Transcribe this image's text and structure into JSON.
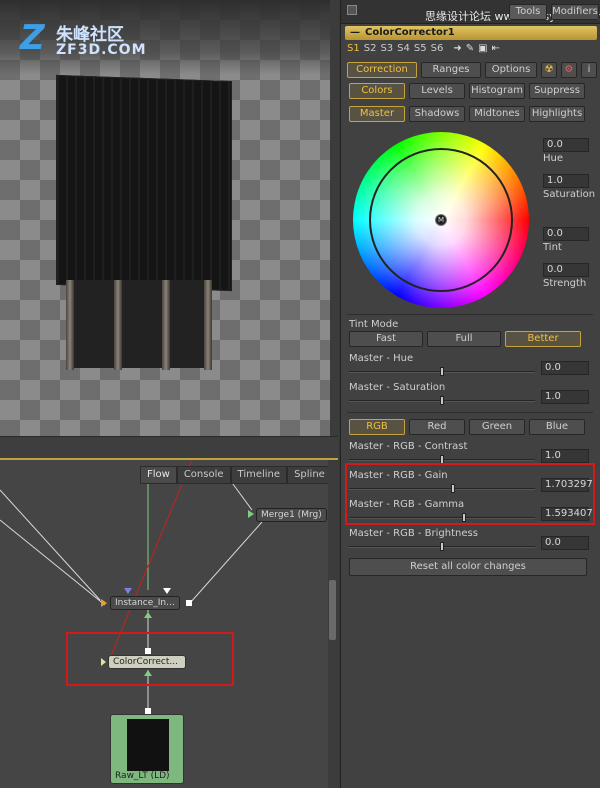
{
  "watermark": {
    "brand": "朱峰社区",
    "site": "ZF3D.COM",
    "top_right": "思缘设计论坛 www.missyuan.com"
  },
  "flow": {
    "tabs": [
      {
        "label": "Flow",
        "active": true
      },
      {
        "label": "Console",
        "active": false
      },
      {
        "label": "Timeline",
        "active": false
      },
      {
        "label": "Spline",
        "active": false
      }
    ],
    "info": "i",
    "nodes": {
      "merge": "Merge1  (Mrg)",
      "instance": "Instance_In...",
      "colorcorrector": "ColorCorrect...",
      "raw": "Raw_LT (LD)"
    }
  },
  "panel": {
    "header_tabs": [
      "Tools",
      "Modifiers"
    ],
    "title": "ColorCorrector1",
    "slots": [
      "S1",
      "S2",
      "S3",
      "S4",
      "S5",
      "S6"
    ],
    "tabs": [
      {
        "label": "Correction",
        "active": true
      },
      {
        "label": "Ranges",
        "active": false
      },
      {
        "label": "Options",
        "active": false
      }
    ],
    "modes": [
      {
        "label": "Colors",
        "active": true
      },
      {
        "label": "Levels",
        "active": false
      },
      {
        "label": "Histogram",
        "active": false
      },
      {
        "label": "Suppress",
        "active": false
      }
    ],
    "ranges": [
      {
        "label": "Master",
        "active": true
      },
      {
        "label": "Shadows",
        "active": false
      },
      {
        "label": "Midtones",
        "active": false
      },
      {
        "label": "Highlights",
        "active": false
      }
    ],
    "wheel": {
      "center_label": "M",
      "hue": {
        "label": "Hue",
        "value": "0.0"
      },
      "saturation": {
        "label": "Saturation",
        "value": "1.0"
      },
      "tint": {
        "label": "Tint",
        "value": "0.0"
      },
      "strength": {
        "label": "Strength",
        "value": "0.0"
      }
    },
    "tint_mode": {
      "label": "Tint Mode",
      "options": [
        {
          "label": "Fast",
          "active": false
        },
        {
          "label": "Full",
          "active": false
        },
        {
          "label": "Better",
          "active": true
        }
      ]
    },
    "sliders_top": [
      {
        "label": "Master - Hue",
        "value": "0.0",
        "level": 0.5
      },
      {
        "label": "Master - Saturation",
        "value": "1.0",
        "level": 0.5
      }
    ],
    "channels": [
      {
        "label": "RGB",
        "active": true
      },
      {
        "label": "Red",
        "active": false
      },
      {
        "label": "Green",
        "active": false
      },
      {
        "label": "Blue",
        "active": false
      }
    ],
    "sliders_rgb": [
      {
        "label": "Master - RGB - Contrast",
        "value": "1.0",
        "level": 0.5
      },
      {
        "label": "Master - RGB - Gain",
        "value": "1.703297",
        "level": 0.56
      },
      {
        "label": "Master - RGB - Gamma",
        "value": "1.593407",
        "level": 0.62
      },
      {
        "label": "Master - RGB - Brightness",
        "value": "0.0",
        "level": 0.5
      }
    ],
    "reset_label": "Reset all color changes"
  }
}
